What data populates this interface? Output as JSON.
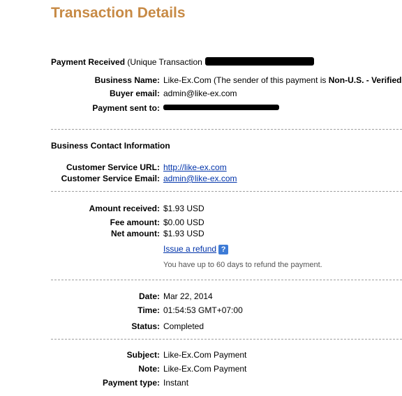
{
  "title": "Transaction Details",
  "payment": {
    "received_label": "Payment Received",
    "transaction_prefix": "(Unique Transaction",
    "business_name_label": "Business Name:",
    "business_name_value": "Like-Ex.Com (The sender of this payment is ",
    "business_name_bold": "Non-U.S. - Verified",
    "buyer_email_label": "Buyer email:",
    "buyer_email_value": "admin@like-ex.com",
    "sent_to_label": "Payment sent to:"
  },
  "contact": {
    "heading": "Business Contact Information",
    "url_label": "Customer Service URL:",
    "url_value": "http://like-ex.com",
    "email_label": "Customer Service Email:",
    "email_value": "admin@like-ex.com"
  },
  "amounts": {
    "received_label": "Amount received:",
    "received_value": "$1.93 USD",
    "fee_label": "Fee amount:",
    "fee_value": "$0.00 USD",
    "net_label": "Net amount:",
    "net_value": "$1.93 USD",
    "refund_link": "Issue a refund",
    "help_glyph": "?",
    "refund_note": "You have up to 60 days to refund the payment."
  },
  "details": {
    "date_label": "Date:",
    "date_value": "Mar 22, 2014",
    "time_label": "Time:",
    "time_value": "01:54:53 GMT+07:00",
    "status_label": "Status:",
    "status_value": "Completed"
  },
  "meta": {
    "subject_label": "Subject:",
    "subject_value": "Like-Ex.Com Payment",
    "note_label": "Note:",
    "note_value": "Like-Ex.Com Payment",
    "type_label": "Payment type:",
    "type_value": "Instant"
  },
  "icons": {
    "help": "help-question-icon"
  }
}
